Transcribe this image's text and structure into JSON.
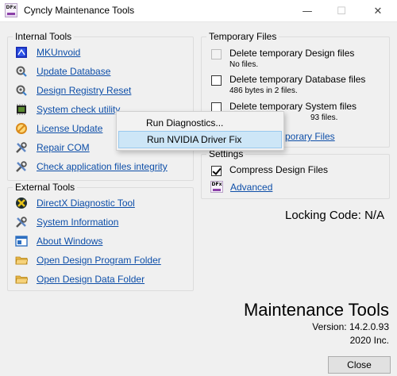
{
  "window": {
    "title": "Cyncly Maintenance Tools",
    "icon_text": "DFx",
    "minimize_glyph": "—",
    "maximize_glyph": "☐",
    "close_glyph": "✕"
  },
  "internal_tools": {
    "title": "Internal Tools",
    "items": [
      {
        "label": "MKUnvoid",
        "icon": "mkunvoid-icon"
      },
      {
        "label": "Update Database",
        "icon": "gear-search-icon"
      },
      {
        "label": "Design Registry Reset",
        "icon": "gear-search-icon"
      },
      {
        "label": "System check utility",
        "icon": "chip-icon"
      },
      {
        "label": "License Update",
        "icon": "no-entry-icon"
      },
      {
        "label": "Repair COM",
        "icon": "tools-icon"
      },
      {
        "label": "Check application files integrity",
        "icon": "tools-icon"
      }
    ]
  },
  "external_tools": {
    "title": "External Tools",
    "items": [
      {
        "label": "DirectX Diagnostic Tool",
        "icon": "directx-icon"
      },
      {
        "label": "System Information",
        "icon": "tools-icon"
      },
      {
        "label": "About Windows",
        "icon": "window-icon"
      },
      {
        "label": "Open Design Program Folder",
        "icon": "folder-icon"
      },
      {
        "label": "Open Design Data Folder",
        "icon": "folder-icon"
      }
    ]
  },
  "temporary_files": {
    "title": "Temporary Files",
    "items": [
      {
        "label": "Delete temporary Design files",
        "detail": "No files.",
        "checked": false,
        "disabled": true
      },
      {
        "label": "Delete temporary Database files",
        "detail": "486 bytes in 2 files.",
        "checked": false,
        "disabled": false
      },
      {
        "label": "Delete temporary System files",
        "detail": "93 files.",
        "checked": false,
        "disabled": false
      }
    ],
    "link_text": "porary Files"
  },
  "settings": {
    "title": "Settings",
    "compress_label": "Compress Design Files",
    "compress_checked": true,
    "advanced_label": "Advanced",
    "advanced_icon_text": "DFx"
  },
  "locking_code": "Locking Code: N/A",
  "brand": {
    "title": "Maintenance Tools",
    "version": "Version: 14.2.0.93",
    "company": "2020 Inc."
  },
  "close_button": "Close",
  "context_menu": {
    "items": [
      {
        "label": "Run Diagnostics...",
        "highlighted": false
      },
      {
        "label": "Run NVIDIA Driver Fix",
        "highlighted": true
      }
    ]
  }
}
